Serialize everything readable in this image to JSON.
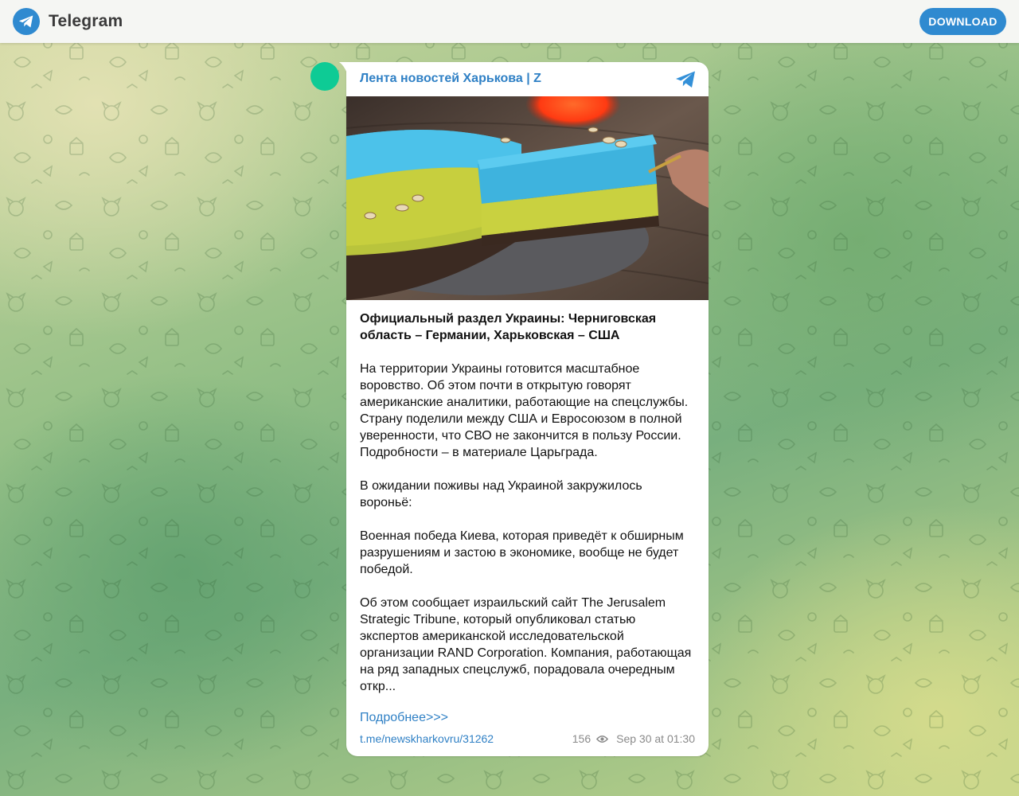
{
  "header": {
    "brand": "Telegram",
    "download_label": "DOWNLOAD"
  },
  "post": {
    "channel_name": "Лента новостей Харькова | Z",
    "title": "Официальный раздел Украины: Черниговская область – Германии, Харьковская – США",
    "paragraphs": [
      "На территории Украины готовится масштабное воровство. Об этом почти в открытую говорят американские аналитики, работающие на спецслужбы. Страну поделили между США и Евросоюзом в полной уверенности, что СВО не закончится в пользу России. Подробности – в материале Царьграда.",
      "В ожидании поживы над Украиной закружилось вороньё:",
      "Военная победа Киева, которая приведёт к обширным разрушениям и застою в экономике, вообще не будет победой.",
      "Об этом сообщает израильский сайт The Jerusalem Strategic Tribune, который опубликовал статью экспертов американской исследовательской организации RAND Corporation. Компания, работающая на ряд западных спецслужб, порадовала очередным откр..."
    ],
    "read_more": "Подробнее>>>",
    "link": "t.me/newskharkovru/31262",
    "views": "156",
    "date": "Sep 30 at 01:30"
  },
  "colors": {
    "accent": "#2f8ad0",
    "link": "#2f80c5",
    "avatar": "#0ecb95"
  },
  "icons": {
    "logo": "telegram-logo-icon",
    "channel": "telegram-plane-icon",
    "views": "eye-icon"
  }
}
